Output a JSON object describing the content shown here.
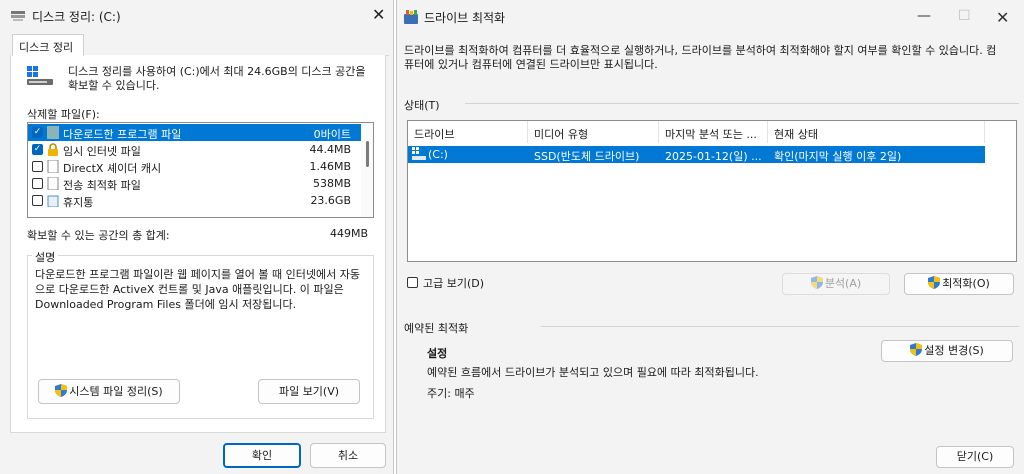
{
  "disk_cleanup": {
    "title": "디스크 정리: (C:)",
    "tab": "디스크 정리",
    "intro": "디스크 정리를 사용하여 (C:)에서 최대 24.6GB의 디스크 공간을 확보할 수 있습니다.",
    "files_label": "삭제할 파일(F):",
    "items": [
      {
        "label": "다운로드한 프로그램 파일",
        "size": "0바이트",
        "checked": true,
        "selected": true
      },
      {
        "label": "임시 인터넷 파일",
        "size": "44.4MB",
        "checked": true,
        "selected": false
      },
      {
        "label": "DirectX 셰이더 캐시",
        "size": "1.46MB",
        "checked": false,
        "selected": false
      },
      {
        "label": "전송 최적화 파일",
        "size": "538MB",
        "checked": false,
        "selected": false
      },
      {
        "label": "휴지통",
        "size": "23.6GB",
        "checked": false,
        "selected": false
      }
    ],
    "total_label": "확보할 수 있는 공간의 총 합계:",
    "total_value": "449MB",
    "description_title": "설명",
    "description": "다운로드한 프로그램 파일이란 웹 페이지를 열어 볼 때 인터넷에서 자동으로 다운로드한 ActiveX 컨트롤 및 Java 애플릿입니다. 이 파일은 Downloaded Program Files 폴더에 임시 저장됩니다.",
    "cleanup_system_button": "시스템 파일 정리(S)",
    "view_files_button": "파일 보기(V)",
    "ok_button": "확인",
    "cancel_button": "취소"
  },
  "optimize_drives": {
    "title": "드라이브 최적화",
    "intro": "드라이브를 최적화하여 컴퓨터를 더 효율적으로 실행하거나, 드라이브를 분석하여 최적화해야 할지 여부를 확인할 수 있습니다. 컴퓨터에 있거나 컴퓨터에 연결된 드라이브만 표시됩니다.",
    "status_label": "상태(T)",
    "columns": [
      "드라이브",
      "미디어 유형",
      "마지막 분석 또는 ...",
      "현재 상태"
    ],
    "drives": [
      {
        "drive": "(C:)",
        "media": "SSD(반도체 드라이브)",
        "last": "2025-01-12(일) ...",
        "status": "확인(마지막 실행 이후 2일)"
      }
    ],
    "advanced_view": "고급 보기(D)",
    "analyze_button": "분석(A)",
    "optimize_button": "최적화(O)",
    "scheduled_label": "예약된 최적화",
    "settings_title": "설정",
    "change_settings_button": "설정 변경(S)",
    "schedule_text": "예약된 흐름에서 드라이브가 분석되고 있으며 필요에 따라 최적화됩니다.",
    "frequency": "주기: 매주",
    "close_button": "닫기(C)"
  },
  "colors": {
    "selection": "#0078d4",
    "checkbox": "#0067c0"
  }
}
